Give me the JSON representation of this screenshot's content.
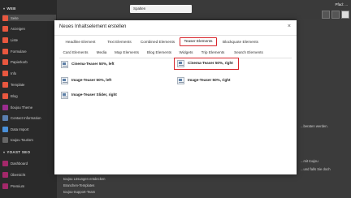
{
  "sidebar": {
    "sections": [
      {
        "label": "WEB",
        "items": [
          {
            "label": "Seite",
            "icon": "page-icon",
            "color": "#e8573f",
            "active": true
          },
          {
            "label": "Anzeigen",
            "icon": "view-icon",
            "color": "#e8573f"
          },
          {
            "label": "Liste",
            "icon": "list-icon",
            "color": "#e8573f"
          },
          {
            "label": "Formulare",
            "icon": "form-icon",
            "color": "#e8573f"
          },
          {
            "label": "Papierkorb",
            "icon": "trash-icon",
            "color": "#e8573f"
          },
          {
            "label": "Info",
            "icon": "info-icon",
            "color": "#e8573f"
          },
          {
            "label": "Template",
            "icon": "template-icon",
            "color": "#e8573f"
          },
          {
            "label": "Blog",
            "icon": "blog-icon",
            "color": "#e8573f"
          },
          {
            "label": "tloujou Theme",
            "icon": "theme-icon",
            "color": "#9b2d8f"
          },
          {
            "label": "Contact Information",
            "icon": "contact-icon",
            "color": "#5a7fb0"
          },
          {
            "label": "Data Import",
            "icon": "import-icon",
            "color": "#4a90d9"
          },
          {
            "label": "toujou Tourism",
            "icon": "tourism-icon",
            "color": "#666666"
          }
        ]
      },
      {
        "label": "YOAST SEO",
        "items": [
          {
            "label": "Dashboard",
            "icon": "dashboard-icon",
            "color": "#a4286a"
          },
          {
            "label": "Übersicht",
            "icon": "overview-icon",
            "color": "#a4286a"
          },
          {
            "label": "Premium",
            "icon": "premium-icon",
            "color": "#a4286a"
          }
        ]
      }
    ]
  },
  "topbar": {
    "search_value": "Spalten",
    "path_label": "Pfad: ..."
  },
  "background_peek": [
    "...beraten werden.",
    "...mit toujou",
    "...und falls Sie doch",
    "toujou Lösungen entdecken",
    "Branchen-Templates",
    "toujou-Support-Team"
  ],
  "modal": {
    "title": "Neues Inhaltselement erstellen",
    "close": "×",
    "tabs_row1": [
      "Headline Element",
      "Text Elements",
      "Combined Elements",
      "Teaser Elements",
      "Blockquote Elements"
    ],
    "tabs_row2": [
      "Card Elements",
      "Media",
      "Map Elements",
      "Blog Elements",
      "Widgets",
      "Trip Elements",
      "Search Elements"
    ],
    "active_tab": "Teaser Elements",
    "elements": [
      {
        "label": "Cinema-Teaser 50%, left"
      },
      {
        "label": "Cinema-Teaser 50%, right"
      },
      {
        "label": "Image-Teaser 50%, left"
      },
      {
        "label": "Image-Teaser 50%, right"
      },
      {
        "label": "Image-Teaser Slider, right"
      }
    ],
    "highlight_color": "#d8252b"
  }
}
